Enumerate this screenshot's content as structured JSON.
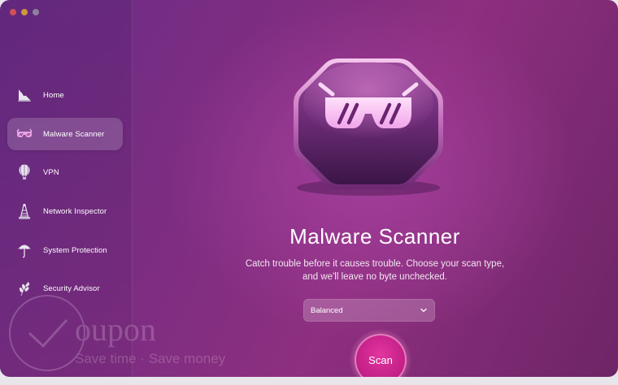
{
  "window": {
    "traffic_lights": [
      "close",
      "minimize",
      "zoom"
    ]
  },
  "sidebar": {
    "items": [
      {
        "label": "Home",
        "icon": "home-icon",
        "active": false
      },
      {
        "label": "Malware Scanner",
        "icon": "sunglasses-icon",
        "active": true
      },
      {
        "label": "VPN",
        "icon": "vpn-balloon-icon",
        "active": false
      },
      {
        "label": "Network Inspector",
        "icon": "network-icon",
        "active": false
      },
      {
        "label": "System Protection",
        "icon": "umbrella-icon",
        "active": false
      },
      {
        "label": "Security Advisor",
        "icon": "leaf-icon",
        "active": false
      }
    ]
  },
  "main": {
    "hero_icon": "malware-scanner-sunglasses-icon",
    "title": "Malware Scanner",
    "subtitle_line1": "Catch trouble before it causes trouble. Choose your scan type,",
    "subtitle_line2": "and we'll leave no byte unchecked.",
    "scan_type": {
      "selected": "Balanced"
    },
    "scan_button_label": "Scan"
  },
  "watermark": {
    "logo_text": "oupon",
    "tagline": "Save time · Save money"
  },
  "colors": {
    "accent": "#c11e85",
    "background_start": "#6a2c86",
    "background_end": "#8e2f7f"
  }
}
